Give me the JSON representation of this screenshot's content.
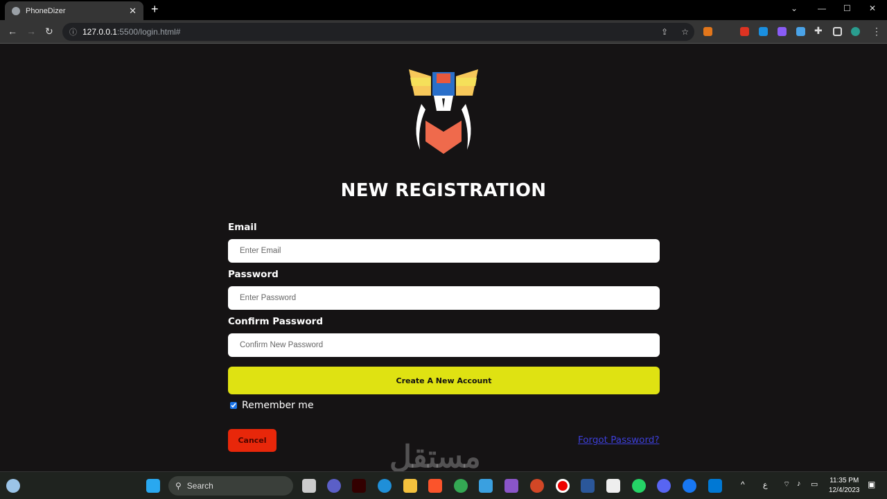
{
  "browser": {
    "tab_title": "PhoneDizer",
    "url_host": "127.0.0.1",
    "url_path": ":5500/login.html#"
  },
  "page": {
    "title": "NEW REGISTRATION",
    "email_label": "Email",
    "email_placeholder": "Enter Email",
    "password_label": "Password",
    "password_placeholder": "Enter Password",
    "confirm_label": "Confirm Password",
    "confirm_placeholder": "Confirm New Password",
    "create_button": "Create A New Account",
    "remember_label": "Remember me",
    "remember_checked": true,
    "cancel_button": "Cancel",
    "forgot_link": "Forgot Password?",
    "accent_color": "#dfe212",
    "cancel_color": "#e8270a"
  },
  "watermark": "مستقل",
  "taskbar": {
    "search": "Search",
    "time": "11:35 PM",
    "date": "12/4/2023",
    "lang": "ع"
  }
}
